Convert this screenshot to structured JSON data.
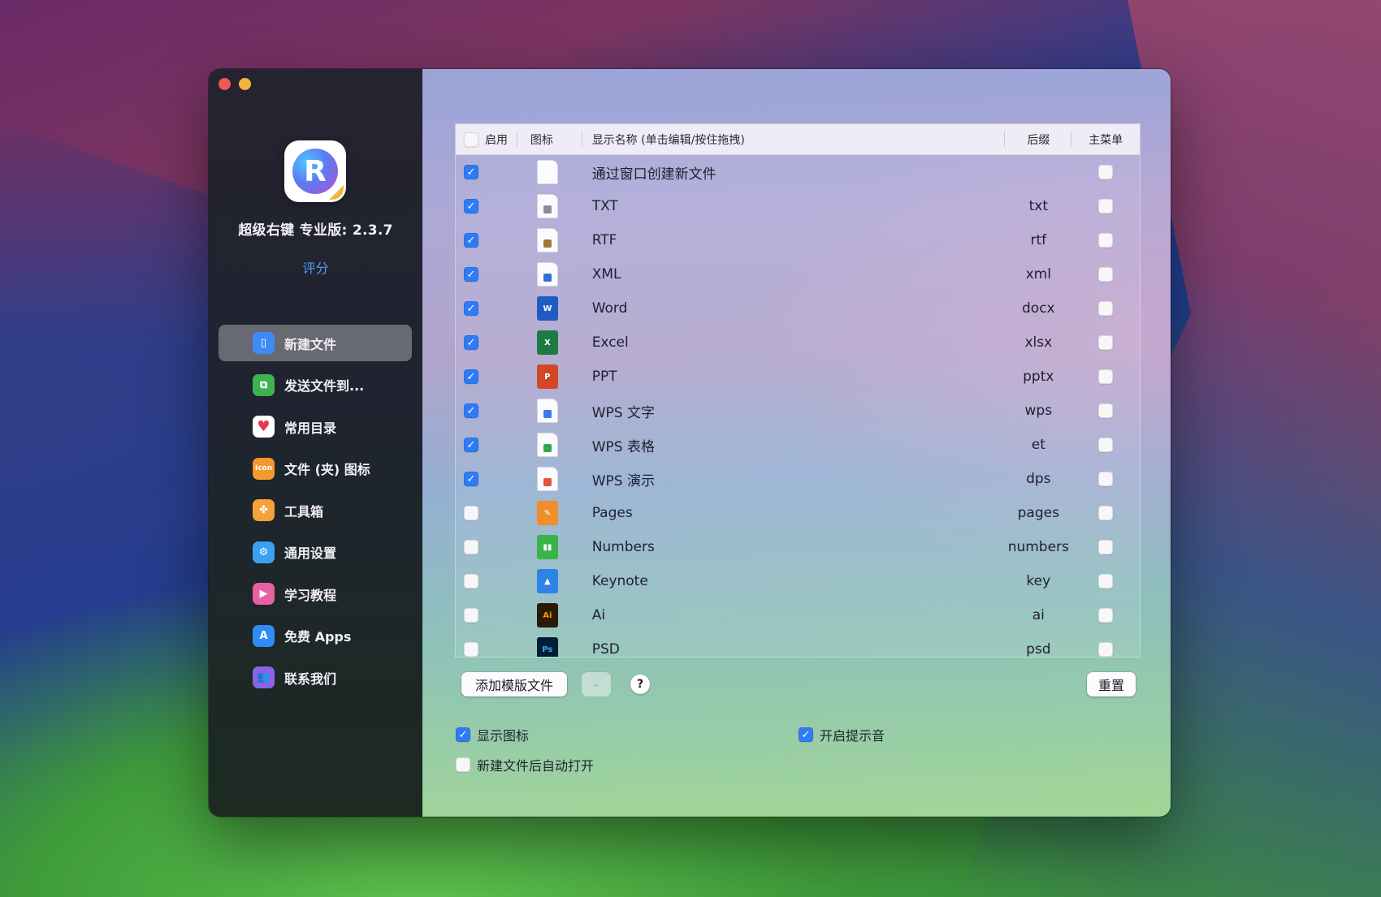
{
  "app": {
    "name": "超级右键 专业版: 2.3.7",
    "rate_label": "评分"
  },
  "sidebar": {
    "items": [
      {
        "label": "新建文件",
        "icon": "new-file-icon",
        "color": "#3d8cf5",
        "active": true
      },
      {
        "label": "发送文件到...",
        "icon": "send-file-icon",
        "color": "#3fb24f",
        "active": false
      },
      {
        "label": "常用目录",
        "icon": "heart-icon",
        "color": "#ffffff",
        "active": false
      },
      {
        "label": "文件 (夹) 图标",
        "icon": "icon-badge-icon",
        "color": "#f39a2e",
        "active": false
      },
      {
        "label": "工具箱",
        "icon": "toolbox-icon",
        "color": "#f5a23a",
        "active": false
      },
      {
        "label": "通用设置",
        "icon": "gear-icon",
        "color": "#3aa0f2",
        "active": false
      },
      {
        "label": "学习教程",
        "icon": "tutorial-icon",
        "color": "#e760a5",
        "active": false
      },
      {
        "label": "免费 Apps",
        "icon": "app-store-icon",
        "color": "#2f8cf6",
        "active": false
      },
      {
        "label": "联系我们",
        "icon": "contact-icon",
        "color": "#8d63e6",
        "active": false
      }
    ]
  },
  "table": {
    "headers": {
      "enable": "启用",
      "icon": "图标",
      "name": "显示名称 (单击编辑/按住拖拽)",
      "suffix": "后缀",
      "main_menu": "主菜单"
    },
    "rows": [
      {
        "enabled": true,
        "icon": "blank-document-icon",
        "name": "通过窗口创建新文件",
        "suffix": "",
        "main_menu": false
      },
      {
        "enabled": true,
        "icon": "txt-file-icon",
        "name": "TXT",
        "suffix": "txt",
        "main_menu": false
      },
      {
        "enabled": true,
        "icon": "rtf-file-icon",
        "name": "RTF",
        "suffix": "rtf",
        "main_menu": false
      },
      {
        "enabled": true,
        "icon": "xml-file-icon",
        "name": "XML",
        "suffix": "xml",
        "main_menu": false
      },
      {
        "enabled": true,
        "icon": "word-icon",
        "name": "Word",
        "suffix": "docx",
        "main_menu": false
      },
      {
        "enabled": true,
        "icon": "excel-icon",
        "name": "Excel",
        "suffix": "xlsx",
        "main_menu": false
      },
      {
        "enabled": true,
        "icon": "powerpoint-icon",
        "name": "PPT",
        "suffix": "pptx",
        "main_menu": false
      },
      {
        "enabled": true,
        "icon": "wps-writer-icon",
        "name": "WPS 文字",
        "suffix": "wps",
        "main_menu": false
      },
      {
        "enabled": true,
        "icon": "wps-spreadsheet-icon",
        "name": "WPS 表格",
        "suffix": "et",
        "main_menu": false
      },
      {
        "enabled": true,
        "icon": "wps-presentation-icon",
        "name": "WPS 演示",
        "suffix": "dps",
        "main_menu": false
      },
      {
        "enabled": false,
        "icon": "pages-icon",
        "name": "Pages",
        "suffix": "pages",
        "main_menu": false
      },
      {
        "enabled": false,
        "icon": "numbers-icon",
        "name": "Numbers",
        "suffix": "numbers",
        "main_menu": false
      },
      {
        "enabled": false,
        "icon": "keynote-icon",
        "name": "Keynote",
        "suffix": "key",
        "main_menu": false
      },
      {
        "enabled": false,
        "icon": "illustrator-icon",
        "name": "Ai",
        "suffix": "ai",
        "main_menu": false
      },
      {
        "enabled": false,
        "icon": "photoshop-icon",
        "name": "PSD",
        "suffix": "psd",
        "main_menu": false
      }
    ]
  },
  "actions": {
    "add_template": "添加模版文件",
    "remove": "-",
    "help": "?",
    "reset": "重置"
  },
  "options": {
    "show_icon": {
      "label": "显示图标",
      "checked": true
    },
    "auto_open": {
      "label": "新建文件后自动打开",
      "checked": false
    },
    "sound": {
      "label": "开启提示音",
      "checked": true
    }
  }
}
